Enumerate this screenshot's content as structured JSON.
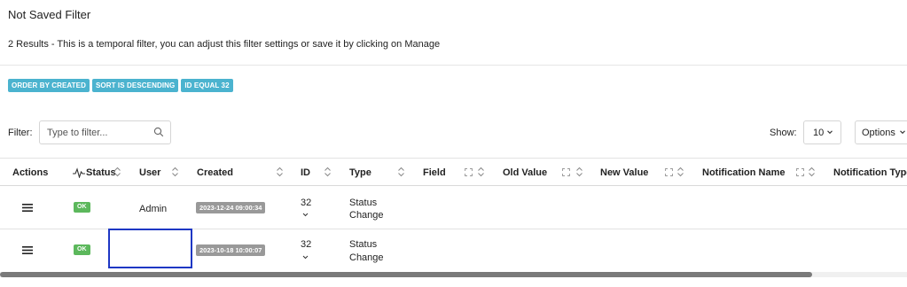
{
  "header": {
    "title": "Not Saved Filter",
    "subtitle": "2 Results - This is a temporal filter, you can adjust this filter settings or save it by clicking on Manage"
  },
  "tags": [
    "ORDER BY CREATED",
    "SORT IS DESCENDING",
    "ID EQUAL 32"
  ],
  "filter": {
    "label": "Filter:",
    "placeholder": "Type to filter...",
    "value": ""
  },
  "show": {
    "label": "Show:",
    "value": "10"
  },
  "options": {
    "label": "Options"
  },
  "columns": {
    "actions": "Actions",
    "status": "Status",
    "user": "User",
    "created": "Created",
    "id": "ID",
    "type": "Type",
    "field": "Field",
    "old_value": "Old Value",
    "new_value": "New Value",
    "notification_name": "Notification Name",
    "notification_type": "Notification Type"
  },
  "rows": [
    {
      "status": "OK",
      "user": "Admin",
      "created": "2023-12-24 09:00:34",
      "id": "32",
      "type_line1": "Status",
      "type_line2": "Change"
    },
    {
      "status": "OK",
      "user": "",
      "created": "2023-10-18 10:00:07",
      "id": "32",
      "type_line1": "Status",
      "type_line2": "Change"
    }
  ],
  "colors": {
    "tag": "#4bb3cf",
    "ok": "#5cb85c",
    "date_badge": "#999999",
    "highlight": "#1e37c4"
  },
  "icons": [
    "pulse-icon",
    "search-icon",
    "chevron-down-icon",
    "sort-icon",
    "expand-icon",
    "hamburger-icon"
  ]
}
